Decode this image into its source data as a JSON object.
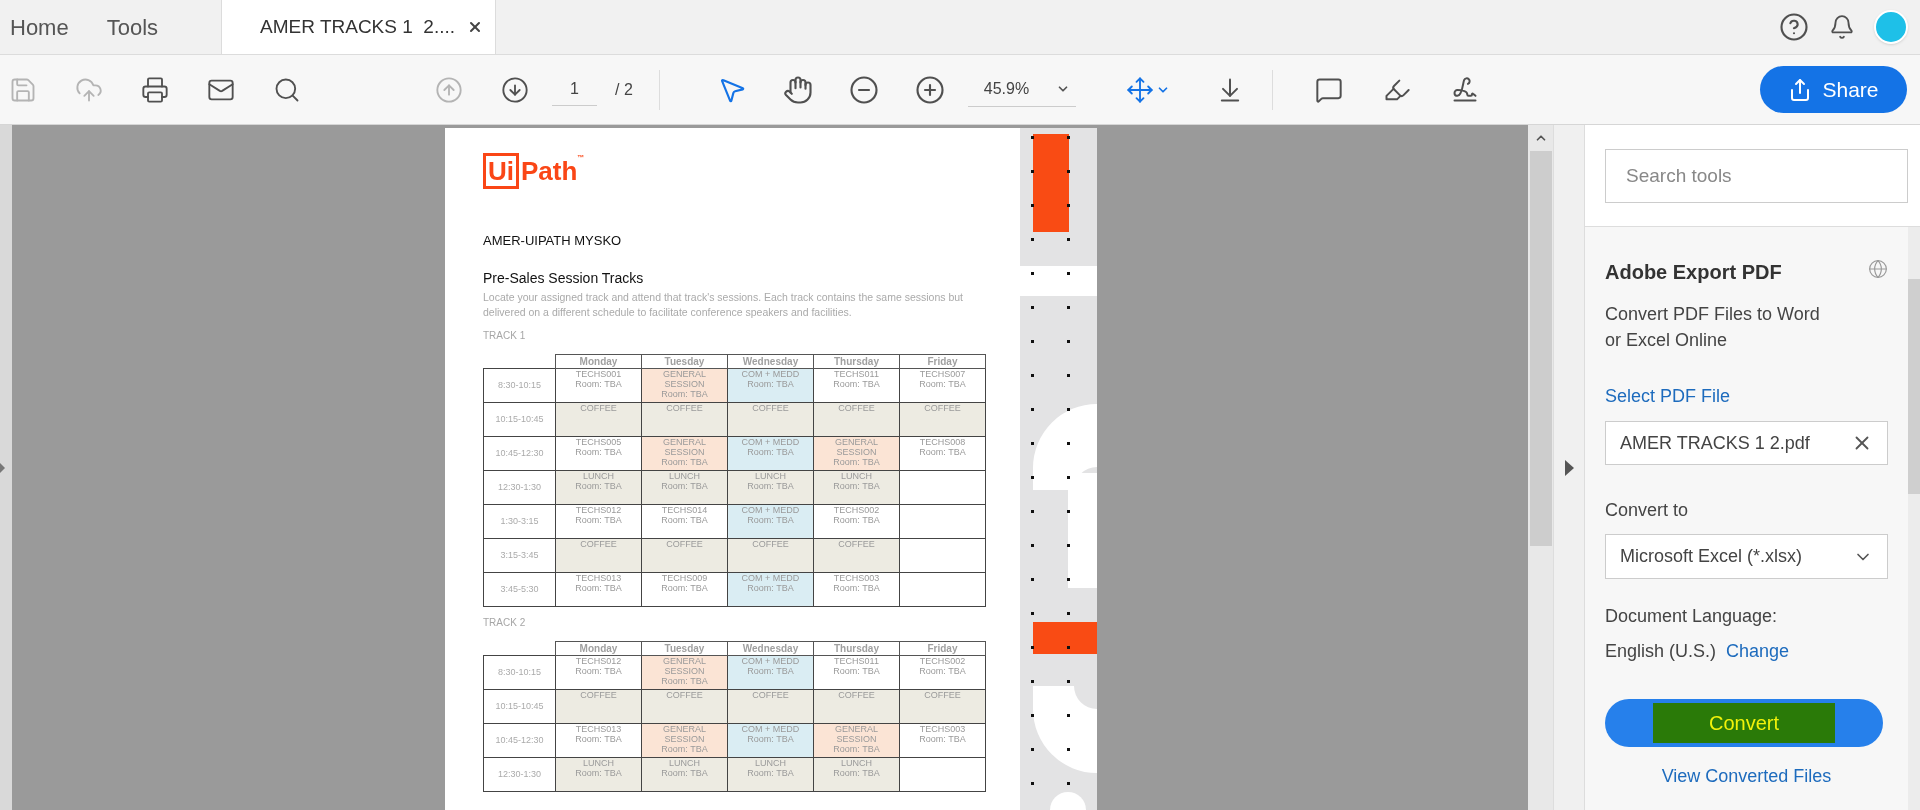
{
  "tabs": [
    {
      "label": "Home",
      "selected": false
    },
    {
      "label": "Tools",
      "selected": false
    },
    {
      "label": "AMER TRACKS 1  2....",
      "selected": true
    }
  ],
  "toolbar": {
    "file_tools": [
      {
        "kind": "save",
        "disabled": true
      },
      {
        "kind": "upload",
        "disabled": true
      },
      {
        "kind": "print",
        "disabled": false
      },
      {
        "kind": "mail",
        "disabled": false
      },
      {
        "kind": "find",
        "disabled": false
      }
    ],
    "page_nav": [
      {
        "kind": "up",
        "disabled": true
      },
      {
        "kind": "down",
        "disabled": false
      }
    ],
    "page_number": "1",
    "page_total": "/ 2",
    "zoom": "45.9%",
    "share": "Share"
  },
  "document": {
    "logo": {
      "boxed": "Ui",
      "rest": "Path",
      "mark": "™"
    },
    "title": "AMER-UIPATH MYSKO",
    "heading": "Pre-Sales Session Tracks",
    "intro": "Locate your assigned track and attend that track's sessions. Each track contains the same sessions but delivered on a different schedule to facilitate conference speakers and facilities.",
    "tracks": [
      {
        "label": "TRACK 1",
        "days": [
          "Monday",
          "Tuesday",
          "Wednesday",
          "Thursday",
          "Friday"
        ],
        "rows": [
          {
            "time": "8:30-10:15",
            "cells": [
              {
                "kind": "session",
                "lines": [
                  "TECHS001",
                  "Room: TBA"
                ]
              },
              {
                "kind": "general",
                "lines": [
                  "GENERAL",
                  "SESSION",
                  "Room: TBA"
                ]
              },
              {
                "kind": "com",
                "lines": [
                  "COM + MEDD",
                  "Room: TBA"
                ]
              },
              {
                "kind": "session",
                "lines": [
                  "TECHS011",
                  "Room: TBA"
                ]
              },
              {
                "kind": "session",
                "lines": [
                  "TECHS007",
                  "Room: TBA"
                ]
              }
            ]
          },
          {
            "time": "10:15-10:45",
            "cells": [
              {
                "kind": "break",
                "lines": [
                  "COFFEE"
                ]
              },
              {
                "kind": "break",
                "lines": [
                  "COFFEE"
                ]
              },
              {
                "kind": "break",
                "lines": [
                  "COFFEE"
                ]
              },
              {
                "kind": "break",
                "lines": [
                  "COFFEE"
                ]
              },
              {
                "kind": "break",
                "lines": [
                  "COFFEE"
                ]
              }
            ]
          },
          {
            "time": "10:45-12:30",
            "cells": [
              {
                "kind": "session",
                "lines": [
                  "TECHS005",
                  "Room: TBA"
                ]
              },
              {
                "kind": "general",
                "lines": [
                  "GENERAL",
                  "SESSION",
                  "Room: TBA"
                ]
              },
              {
                "kind": "com",
                "lines": [
                  "COM + MEDD",
                  "Room: TBA"
                ]
              },
              {
                "kind": "general",
                "lines": [
                  "GENERAL",
                  "SESSION",
                  "Room: TBA"
                ]
              },
              {
                "kind": "session",
                "lines": [
                  "TECHS008",
                  "Room: TBA"
                ]
              }
            ]
          },
          {
            "time": "12:30-1:30",
            "cells": [
              {
                "kind": "break",
                "lines": [
                  "LUNCH",
                  "Room: TBA"
                ]
              },
              {
                "kind": "break",
                "lines": [
                  "LUNCH",
                  "Room: TBA"
                ]
              },
              {
                "kind": "break",
                "lines": [
                  "LUNCH",
                  "Room: TBA"
                ]
              },
              {
                "kind": "break",
                "lines": [
                  "LUNCH",
                  "Room: TBA"
                ]
              },
              {
                "kind": "empty"
              }
            ]
          },
          {
            "time": "1:30-3:15",
            "cells": [
              {
                "kind": "session",
                "lines": [
                  "TECHS012",
                  "Room: TBA"
                ]
              },
              {
                "kind": "session",
                "lines": [
                  "TECHS014",
                  "Room: TBA"
                ]
              },
              {
                "kind": "com",
                "lines": [
                  "COM + MEDD",
                  "Room: TBA"
                ]
              },
              {
                "kind": "session",
                "lines": [
                  "TECHS002",
                  "Room: TBA"
                ]
              },
              {
                "kind": "empty"
              }
            ]
          },
          {
            "time": "3:15-3:45",
            "cells": [
              {
                "kind": "break",
                "lines": [
                  "COFFEE"
                ]
              },
              {
                "kind": "break",
                "lines": [
                  "COFFEE"
                ]
              },
              {
                "kind": "break",
                "lines": [
                  "COFFEE"
                ]
              },
              {
                "kind": "break",
                "lines": [
                  "COFFEE"
                ]
              },
              {
                "kind": "empty"
              }
            ]
          },
          {
            "time": "3:45-5:30",
            "cells": [
              {
                "kind": "session",
                "lines": [
                  "TECHS013",
                  "Room: TBA"
                ]
              },
              {
                "kind": "session",
                "lines": [
                  "TECHS009",
                  "Room: TBA"
                ]
              },
              {
                "kind": "com",
                "lines": [
                  "COM + MEDD",
                  "Room: TBA"
                ]
              },
              {
                "kind": "session",
                "lines": [
                  "TECHS003",
                  "Room: TBA"
                ]
              },
              {
                "kind": "empty"
              }
            ]
          }
        ]
      },
      {
        "label": "TRACK 2",
        "days": [
          "Monday",
          "Tuesday",
          "Wednesday",
          "Thursday",
          "Friday"
        ],
        "rows": [
          {
            "time": "8:30-10:15",
            "cells": [
              {
                "kind": "session",
                "lines": [
                  "TECHS012",
                  "Room: TBA"
                ]
              },
              {
                "kind": "general",
                "lines": [
                  "GENERAL",
                  "SESSION",
                  "Room: TBA"
                ]
              },
              {
                "kind": "com",
                "lines": [
                  "COM + MEDD",
                  "Room: TBA"
                ]
              },
              {
                "kind": "session",
                "lines": [
                  "TECHS011",
                  "Room: TBA"
                ]
              },
              {
                "kind": "session",
                "lines": [
                  "TECHS002",
                  "Room: TBA"
                ]
              }
            ]
          },
          {
            "time": "10:15-10:45",
            "cells": [
              {
                "kind": "break",
                "lines": [
                  "COFFEE"
                ]
              },
              {
                "kind": "break",
                "lines": [
                  "COFFEE"
                ]
              },
              {
                "kind": "break",
                "lines": [
                  "COFFEE"
                ]
              },
              {
                "kind": "break",
                "lines": [
                  "COFFEE"
                ]
              },
              {
                "kind": "break",
                "lines": [
                  "COFFEE"
                ]
              }
            ]
          },
          {
            "time": "10:45-12:30",
            "cells": [
              {
                "kind": "session",
                "lines": [
                  "TECHS013",
                  "Room: TBA"
                ]
              },
              {
                "kind": "general",
                "lines": [
                  "GENERAL",
                  "SESSION",
                  "Room: TBA"
                ]
              },
              {
                "kind": "com",
                "lines": [
                  "COM + MEDD",
                  "Room: TBA"
                ]
              },
              {
                "kind": "general",
                "lines": [
                  "GENERAL",
                  "SESSION",
                  "Room: TBA"
                ]
              },
              {
                "kind": "session",
                "lines": [
                  "TECHS003",
                  "Room: TBA"
                ]
              }
            ]
          },
          {
            "time": "12:30-1:30",
            "cells": [
              {
                "kind": "break",
                "lines": [
                  "LUNCH",
                  "Room: TBA"
                ]
              },
              {
                "kind": "break",
                "lines": [
                  "LUNCH",
                  "Room: TBA"
                ]
              },
              {
                "kind": "break",
                "lines": [
                  "LUNCH",
                  "Room: TBA"
                ]
              },
              {
                "kind": "break",
                "lines": [
                  "LUNCH",
                  "Room: TBA"
                ]
              },
              {
                "kind": "empty"
              }
            ]
          }
        ]
      }
    ]
  },
  "panel": {
    "search": {
      "placeholder": "Search tools"
    },
    "title": "Adobe Export PDF",
    "description": "Convert PDF Files to Word or Excel Online",
    "select_link": "Select PDF File",
    "file": "AMER TRACKS 1 2.pdf",
    "convert_to_label": "Convert to",
    "format": "Microsoft Excel (*.xlsx)",
    "language_label": "Document Language:",
    "language": "English (U.S.)",
    "change_link": "Change",
    "convert": "Convert",
    "view_link": "View Converted Files"
  }
}
